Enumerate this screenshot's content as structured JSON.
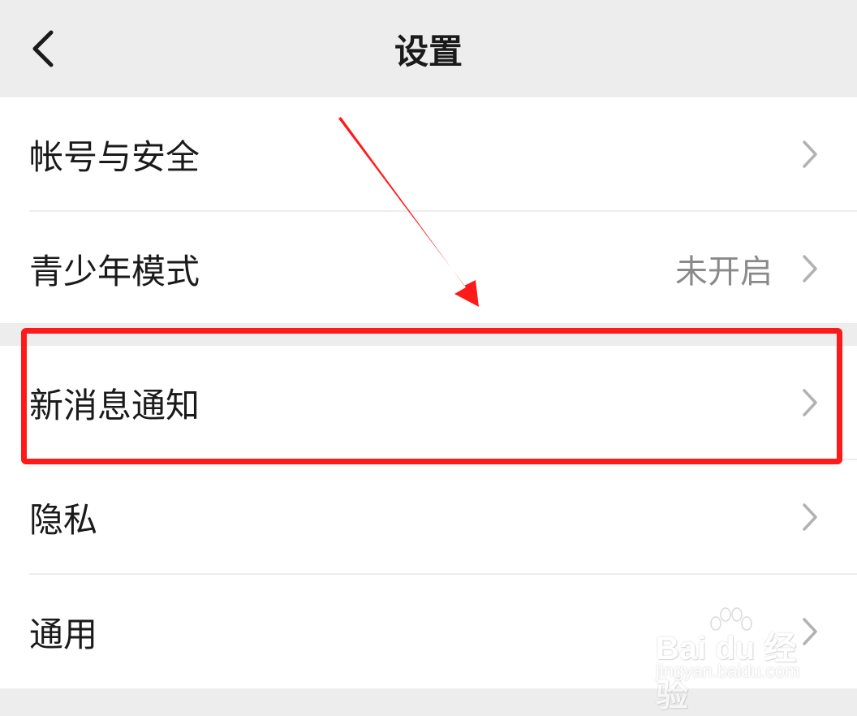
{
  "header": {
    "title": "设置",
    "back_icon": "chevron-left-icon"
  },
  "groups": [
    {
      "items": [
        {
          "label": "帐号与安全",
          "value": ""
        },
        {
          "label": "青少年模式",
          "value": "未开启"
        }
      ]
    },
    {
      "items": [
        {
          "label": "新消息通知",
          "value": ""
        },
        {
          "label": "隐私",
          "value": ""
        },
        {
          "label": "通用",
          "value": ""
        }
      ]
    }
  ],
  "annotation": {
    "highlight_color": "#ff1a1a",
    "highlighted_item": "新消息通知"
  },
  "watermark": {
    "brand": "Bai du 经验",
    "url": "jingyan.baidu.com"
  },
  "colors": {
    "background": "#ededed",
    "row_background": "#ffffff",
    "text": "#1a1a1a",
    "secondary_text": "#8a8a8a"
  }
}
